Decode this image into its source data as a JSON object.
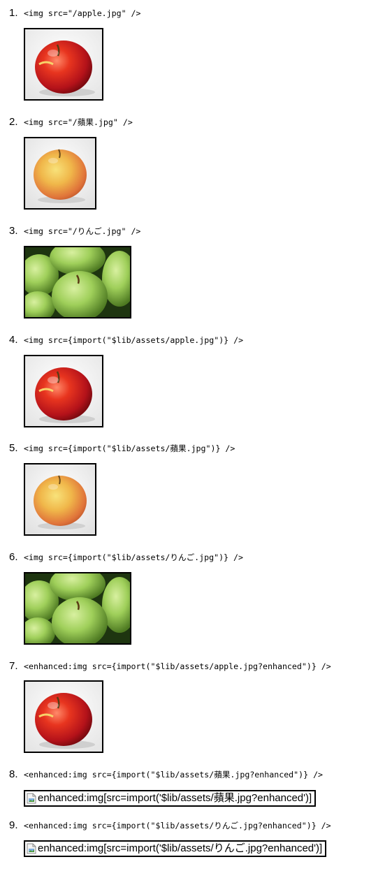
{
  "items": [
    {
      "number": "1.",
      "code": "<img src=\"/apple.jpg\" />",
      "image": "red-apple"
    },
    {
      "number": "2.",
      "code": "<img src=\"/蘋果.jpg\" />",
      "image": "yellow-apple"
    },
    {
      "number": "3.",
      "code": "<img src=\"/りんご.jpg\" />",
      "image": "green-apples"
    },
    {
      "number": "4.",
      "code": "<img src={import(\"$lib/assets/apple.jpg\")} />",
      "image": "red-apple"
    },
    {
      "number": "5.",
      "code": "<img src={import(\"$lib/assets/蘋果.jpg\")} />",
      "image": "yellow-apple"
    },
    {
      "number": "6.",
      "code": "<img src={import(\"$lib/assets/りんご.jpg\")} />",
      "image": "green-apples"
    },
    {
      "number": "7.",
      "code": "<enhanced:img src={import(\"$lib/assets/apple.jpg?enhanced\")} />",
      "image": "red-apple"
    },
    {
      "number": "8.",
      "code": "<enhanced:img src={import(\"$lib/assets/蘋果.jpg?enhanced\")} />",
      "broken_alt": "enhanced:img[src=import('$lib/assets/蘋果.jpg?enhanced')]"
    },
    {
      "number": "9.",
      "code": "<enhanced:img src={import(\"$lib/assets/りんご.jpg?enhanced\")} />",
      "broken_alt": "enhanced:img[src=import('$lib/assets/りんご.jpg?enhanced')]"
    }
  ]
}
